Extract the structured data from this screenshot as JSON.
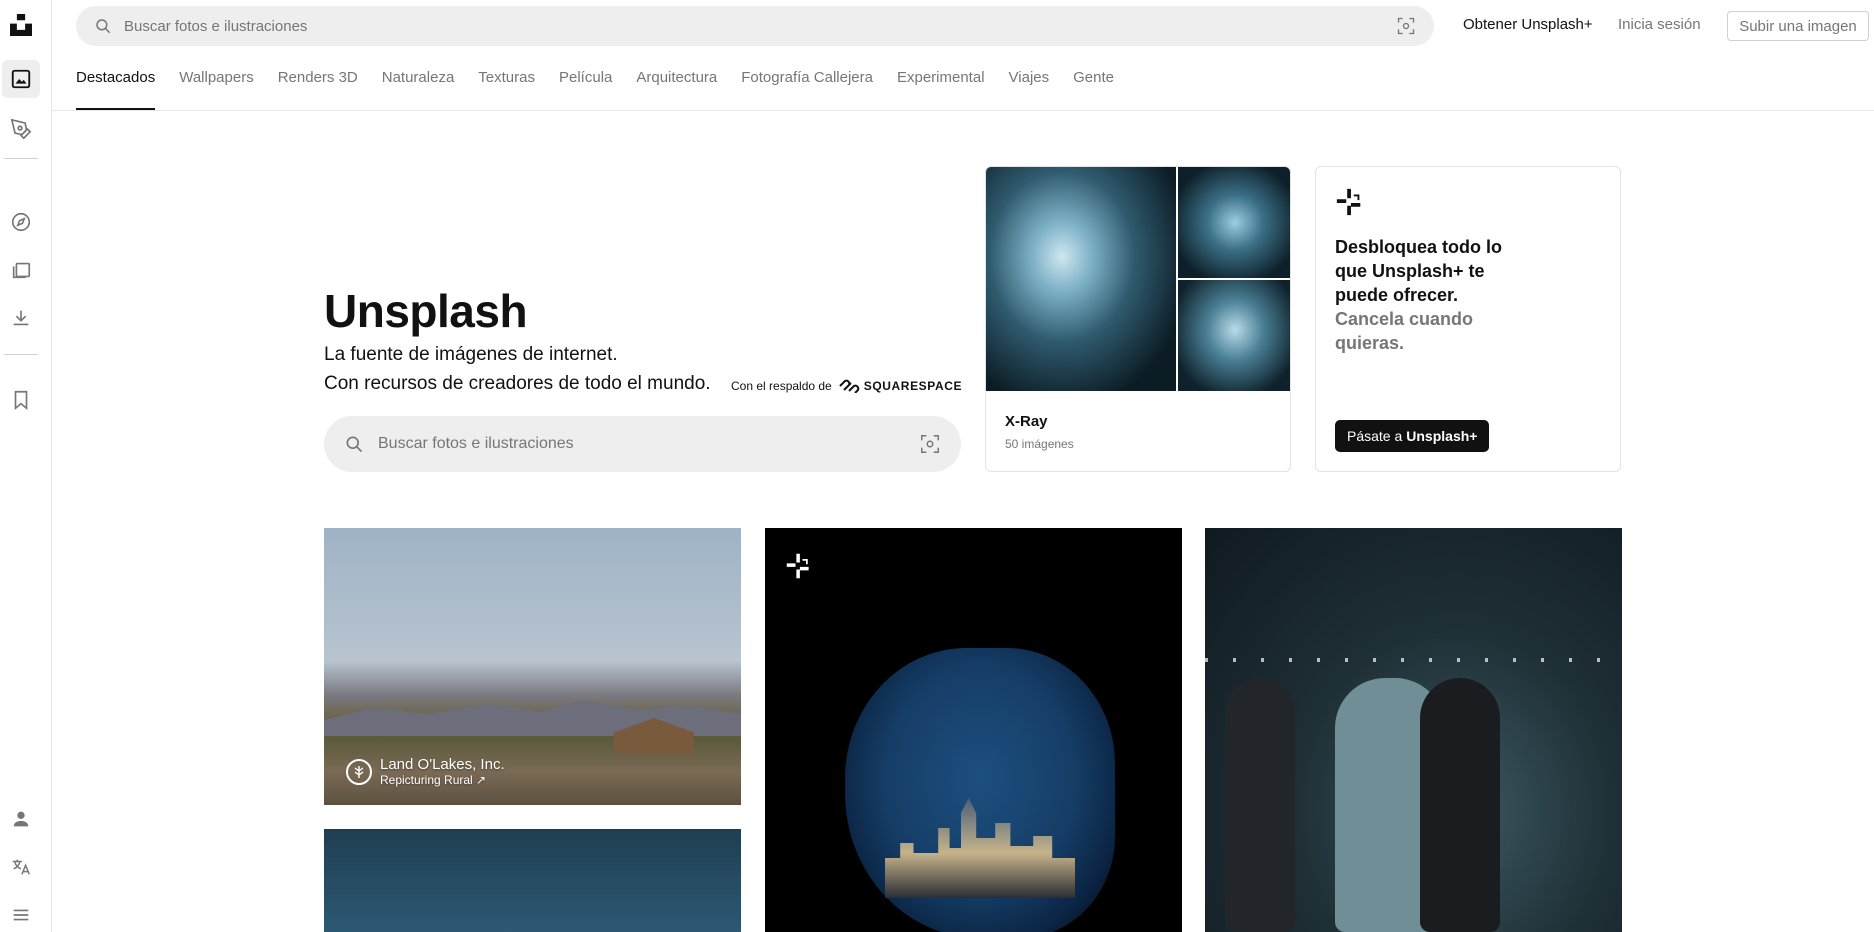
{
  "topbar": {
    "search_placeholder": "Buscar fotos e ilustraciones",
    "get_plus": "Obtener Unsplash+",
    "login": "Inicia sesión",
    "upload": "Subir una imagen"
  },
  "tabs": [
    {
      "label": "Destacados",
      "active": true
    },
    {
      "label": "Wallpapers"
    },
    {
      "label": "Renders 3D"
    },
    {
      "label": "Naturaleza"
    },
    {
      "label": "Texturas"
    },
    {
      "label": "Película"
    },
    {
      "label": "Arquitectura"
    },
    {
      "label": "Fotografía Callejera"
    },
    {
      "label": "Experimental"
    },
    {
      "label": "Viajes"
    },
    {
      "label": "Gente"
    }
  ],
  "hero": {
    "title": "Unsplash",
    "line1": "La fuente de imágenes de internet.",
    "line2": "Con recursos de creadores de todo el mundo.",
    "backed_by": "Con el respaldo de",
    "sponsor": "SQUARESPACE",
    "search_placeholder": "Buscar fotos e ilustraciones"
  },
  "collection_card": {
    "title": "X-Ray",
    "count": "50 imágenes"
  },
  "plus_card": {
    "headline": "Desbloquea todo lo que Unsplash+ te puede ofrecer.",
    "sub": "Cancela cuando quieras.",
    "cta_prefix": "Pásate a",
    "cta_brand": "Unsplash+"
  },
  "photos": {
    "sponsored_name": "Land O'Lakes, Inc.",
    "sponsored_sub": "Repicturing Rural ↗"
  },
  "icons": {
    "rail": [
      "unsplash-logo-icon",
      "photos-icon",
      "illustrations-icon",
      "explore-icon",
      "collections-icon",
      "download-icon",
      "bookmark-icon",
      "user-icon",
      "language-icon",
      "menu-icon"
    ]
  },
  "colors": {
    "text": "#111111",
    "muted": "#767676",
    "search_bg": "#eeeeee",
    "border": "#e3e3e3",
    "cta_bg": "#111111"
  }
}
